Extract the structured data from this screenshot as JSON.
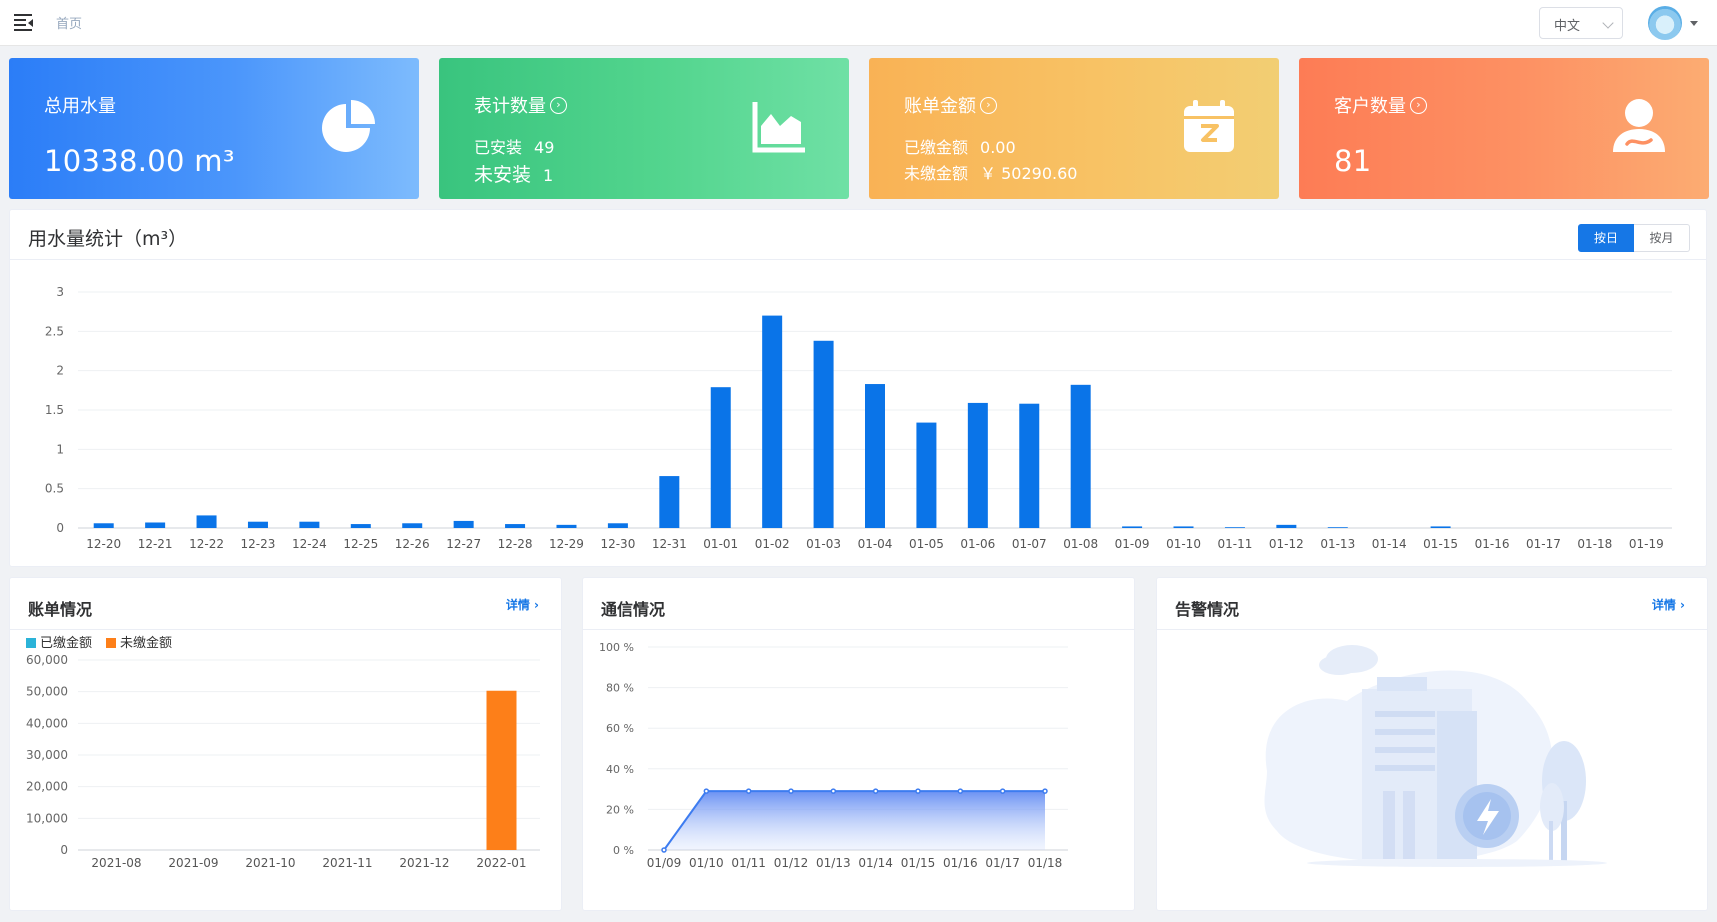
{
  "header": {
    "breadcrumb": "首页",
    "lang": "中文"
  },
  "cards": {
    "water": {
      "title": "总用水量",
      "value": "10338.00 m³"
    },
    "meters": {
      "title": "表计数量",
      "installed_label": "已安装",
      "installed_value": "49",
      "uninstalled_label": "未安装",
      "uninstalled_value": "1"
    },
    "bills": {
      "title": "账单金额",
      "paid_label": "已缴金额",
      "paid_value": "0.00",
      "unpaid_label": "未缴金额",
      "unpaid_value": "￥ 50290.60"
    },
    "customers": {
      "title": "客户数量",
      "value": "81"
    }
  },
  "water_panel": {
    "title": "用水量统计（m³）",
    "btn_day": "按日",
    "btn_month": "按月"
  },
  "bill_panel": {
    "title": "账单情况",
    "detail": "详情"
  },
  "comm_panel": {
    "title": "通信情况"
  },
  "alarm_panel": {
    "title": "告警情况",
    "detail": "详情"
  },
  "colors": {
    "primary": "#1677e6",
    "bar": "#0a74e8",
    "paid": "#2bb3d8",
    "unpaid": "#fd7f19",
    "line": "#3d7cf0"
  },
  "chart_data": [
    {
      "type": "bar",
      "categories": [
        "12-20",
        "12-21",
        "12-22",
        "12-23",
        "12-24",
        "12-25",
        "12-26",
        "12-27",
        "12-28",
        "12-29",
        "12-30",
        "12-31",
        "01-01",
        "01-02",
        "01-03",
        "01-04",
        "01-05",
        "01-06",
        "01-07",
        "01-08",
        "01-09",
        "01-10",
        "01-11",
        "01-12",
        "01-13",
        "01-14",
        "01-15",
        "01-16",
        "01-17",
        "01-18",
        "01-19"
      ],
      "values": [
        0.06,
        0.07,
        0.16,
        0.08,
        0.08,
        0.05,
        0.06,
        0.09,
        0.05,
        0.04,
        0.06,
        0.66,
        1.79,
        2.7,
        2.38,
        1.83,
        1.34,
        1.59,
        1.58,
        1.82,
        0.02,
        0.02,
        0.01,
        0.04,
        0.01,
        0,
        0.02,
        0,
        0,
        0,
        0
      ],
      "yticks": [
        "0",
        "0.5",
        "1",
        "1.5",
        "2",
        "2.5",
        "3"
      ],
      "ylim": [
        0,
        3
      ],
      "grid": true
    },
    {
      "type": "bar",
      "legend": [
        "已缴金额",
        "未缴金额"
      ],
      "categories": [
        "2021-08",
        "2021-09",
        "2021-10",
        "2021-11",
        "2021-12",
        "2022-01"
      ],
      "series": [
        {
          "name": "已缴金额",
          "values": [
            0,
            0,
            0,
            0,
            0,
            0
          ]
        },
        {
          "name": "未缴金额",
          "values": [
            0,
            0,
            0,
            0,
            0,
            50290.6
          ]
        }
      ],
      "yticks": [
        "0",
        "10,000",
        "20,000",
        "30,000",
        "40,000",
        "50,000",
        "60,000"
      ],
      "ylim": [
        0,
        60000
      ],
      "legend_position": "top-left",
      "grid": true
    },
    {
      "type": "area",
      "categories": [
        "01/09",
        "01/10",
        "01/11",
        "01/12",
        "01/13",
        "01/14",
        "01/15",
        "01/16",
        "01/17",
        "01/18"
      ],
      "values": [
        0,
        29,
        29,
        29,
        29,
        29,
        29,
        29,
        29,
        29
      ],
      "yticks": [
        "0 %",
        "20 %",
        "40 %",
        "60 %",
        "80 %",
        "100 %"
      ],
      "ylim": [
        0,
        100
      ],
      "grid": true
    }
  ]
}
